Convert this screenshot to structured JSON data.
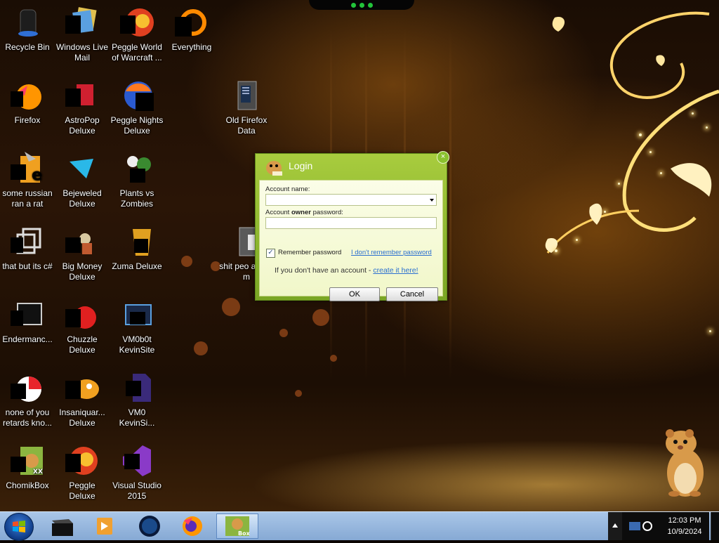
{
  "desktop": {
    "icons": [
      {
        "label": "Recycle Bin",
        "icon": "recycle-bin-icon"
      },
      {
        "label": "Windows Live Mail",
        "icon": "mail-icon"
      },
      {
        "label": "Peggle World of Warcraft ...",
        "icon": "peggle-icon"
      },
      {
        "label": "Everything",
        "icon": "search-app-icon"
      },
      {
        "label": "Firefox",
        "icon": "firefox-icon"
      },
      {
        "label": "AstroPop Deluxe",
        "icon": "astropop-icon"
      },
      {
        "label": "Peggle Nights Deluxe",
        "icon": "peggle-nights-icon"
      },
      {
        "label": "Old Firefox Data",
        "icon": "folder-icon"
      },
      {
        "label": "some russian ran a rat",
        "icon": "shortcut-icon"
      },
      {
        "label": "Bejeweled Deluxe",
        "icon": "bejeweled-icon"
      },
      {
        "label": "Plants vs Zombies",
        "icon": "plants-icon"
      },
      {
        "label": "that but its c#",
        "icon": "shortcut-icon"
      },
      {
        "label": "Big Money Deluxe",
        "icon": "bigmoney-icon"
      },
      {
        "label": "Zuma Deluxe",
        "icon": "zuma-icon"
      },
      {
        "label": "shit peo asked m",
        "icon": "folder-icon"
      },
      {
        "label": "Endermanc...",
        "icon": "app-icon"
      },
      {
        "label": "Chuzzle Deluxe",
        "icon": "chuzzle-icon"
      },
      {
        "label": "VM0b0t KevinSite",
        "icon": "vm-icon"
      },
      {
        "label": "none of you retards kno...",
        "icon": "shortcut-icon"
      },
      {
        "label": "Insaniquar... Deluxe",
        "icon": "insaniquarium-icon"
      },
      {
        "label": "VM0 KevinSi...",
        "icon": "document-icon"
      },
      {
        "label": "ChomikBox",
        "icon": "chomikbox-icon"
      },
      {
        "label": "Peggle Deluxe",
        "icon": "peggle-deluxe-icon"
      },
      {
        "label": "Visual Studio 2015",
        "icon": "visual-studio-icon"
      }
    ]
  },
  "login_dialog": {
    "title": "Login",
    "account_name_label": "Account name:",
    "account_name_value": "",
    "password_label_prefix": "Account ",
    "password_label_bold": "owner",
    "password_label_suffix": " password:",
    "password_value": "",
    "remember_label": "Remember password",
    "remember_checked": true,
    "forgot_link": "I don't remember password",
    "no_account_text": "If you don't have an account - ",
    "create_link": "create it here!",
    "ok_label": "OK",
    "cancel_label": "Cancel",
    "close_symbol": "×"
  },
  "taskbar": {
    "clock_time": "12:03 PM",
    "clock_date": "10/9/2024",
    "items": [
      "explorer-icon",
      "media-player-icon",
      "globe-icon",
      "firefox-icon",
      "chomikbox-icon"
    ]
  },
  "colors": {
    "dialog_green": "#8cb92e",
    "taskbar_blue": "#95b6de",
    "link_blue": "#2a6fd0"
  }
}
